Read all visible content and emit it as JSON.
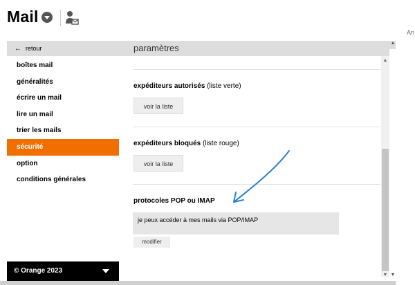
{
  "header": {
    "app_title": "Mail",
    "right_clip_text": "An"
  },
  "sidebar": {
    "back_label": "retour",
    "items": [
      {
        "label": "boîtes mail",
        "active": false
      },
      {
        "label": "généralités",
        "active": false
      },
      {
        "label": "écrire un mail",
        "active": false
      },
      {
        "label": "lire un mail",
        "active": false
      },
      {
        "label": "trier les mails",
        "active": false
      },
      {
        "label": "sécurité",
        "active": true
      },
      {
        "label": "option",
        "active": false
      },
      {
        "label": "conditions générales",
        "active": false
      }
    ],
    "footer_text": "© Orange 2023"
  },
  "main": {
    "title": "paramètres",
    "sections": {
      "whitelist": {
        "title_bold": "expéditeurs autorisés",
        "title_suffix": " (liste verte)",
        "button": "voir la liste"
      },
      "blacklist": {
        "title_bold": "expéditeurs bloqués",
        "title_suffix": " (liste rouge)",
        "button": "voir la liste"
      },
      "protocols": {
        "title": "protocoles POP ou IMAP",
        "value": "je peux accéder à mes mails via POP/IMAP",
        "button": "modifier"
      }
    }
  },
  "colors": {
    "accent": "#f16e00",
    "annotation_arrow": "#2a7fd4",
    "footer_bg": "#000000"
  },
  "icons": {
    "dropdown": "chevron-down-icon",
    "contact": "contact-mail-icon",
    "back": "arrow-left-icon",
    "footer_caret": "caret-down-icon"
  }
}
